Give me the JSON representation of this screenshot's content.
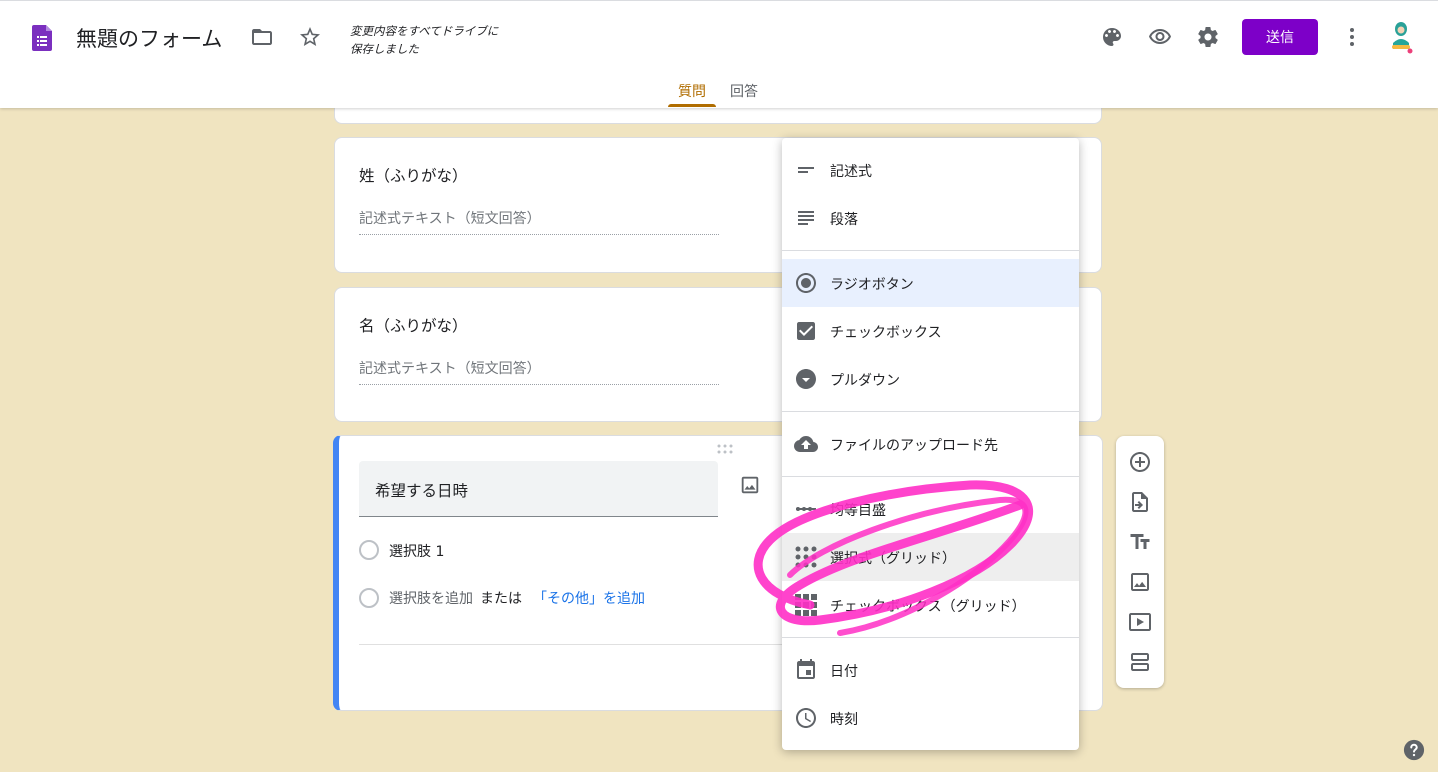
{
  "header": {
    "title": "無題のフォーム",
    "save_status_line1": "変更内容をすべてドライブに",
    "save_status_line2": "保存しました",
    "send_label": "送信",
    "tabs": [
      {
        "label": "質問",
        "active": true
      },
      {
        "label": "回答",
        "active": false
      }
    ],
    "accent_color": "#7d00c8"
  },
  "questions": [
    {
      "title": "姓（ふりがな）",
      "answer_placeholder": "記述式テキスト（短文回答）"
    },
    {
      "title": "名（ふりがな）",
      "answer_placeholder": "記述式テキスト（短文回答）"
    }
  ],
  "active_question": {
    "title": "希望する日時",
    "option_1": "選択肢 1",
    "add_option": "選択肢を追加",
    "or_text": "または",
    "add_other": "「その他」を追加"
  },
  "type_menu": {
    "items": [
      {
        "label": "記述式",
        "icon": "short-text-icon"
      },
      {
        "label": "段落",
        "icon": "paragraph-icon"
      },
      {
        "label": "ラジオボタン",
        "icon": "radio-button-icon"
      },
      {
        "label": "チェックボックス",
        "icon": "checkbox-icon"
      },
      {
        "label": "プルダウン",
        "icon": "dropdown-icon"
      },
      {
        "label": "ファイルのアップロード先",
        "icon": "cloud-upload-icon"
      },
      {
        "label": "均等目盛",
        "icon": "linear-scale-icon"
      },
      {
        "label": "選択式（グリッド）",
        "icon": "radio-grid-icon"
      },
      {
        "label": "チェックボックス（グリッド）",
        "icon": "checkbox-grid-icon"
      },
      {
        "label": "日付",
        "icon": "calendar-icon"
      },
      {
        "label": "時刻",
        "icon": "clock-icon"
      }
    ],
    "selected": "ラジオボタン",
    "highlighted": "選択式（グリッド）"
  },
  "side_toolbar": [
    "add-question-icon",
    "import-questions-icon",
    "add-title-icon",
    "add-image-icon",
    "add-video-icon",
    "add-section-icon"
  ]
}
